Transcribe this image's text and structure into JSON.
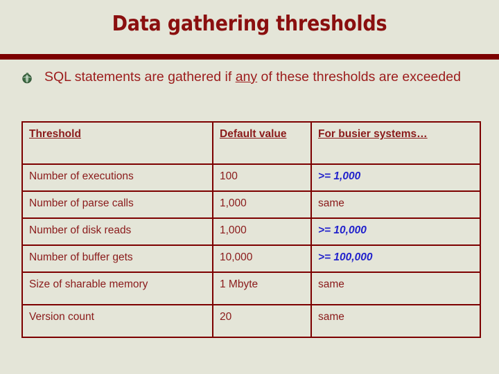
{
  "slide": {
    "title": "Data gathering thresholds",
    "title_color": "#8a0f0f",
    "background_color": "#e4e5d8",
    "divider_color": "#7c0000",
    "accent_color": "#2222cc",
    "body_text_color": "#9c1c1c"
  },
  "bullet": {
    "icon": "globe-bullet-icon",
    "text_before": "SQL statements are gathered if ",
    "text_emphasis": "any",
    "text_after": " of these thresholds are exceeded"
  },
  "table": {
    "headers": [
      "Threshold",
      "Default value",
      "For busier systems…"
    ],
    "rows": [
      {
        "threshold": "Number of executions",
        "default_value": "100",
        "busier": ">= 1,000",
        "busier_accent": true
      },
      {
        "threshold": "Number of parse calls",
        "default_value": "1,000",
        "busier": "same",
        "busier_accent": false
      },
      {
        "threshold": "Number of disk reads",
        "default_value": "1,000",
        "busier": ">= 10,000",
        "busier_accent": true
      },
      {
        "threshold": "Number of buffer gets",
        "default_value": "10,000",
        "busier": ">= 100,000",
        "busier_accent": true
      },
      {
        "threshold": "Size of sharable memory",
        "default_value": "1 Mbyte",
        "busier": "same",
        "busier_accent": false
      },
      {
        "threshold": "Version count",
        "default_value": "20",
        "busier": "same",
        "busier_accent": false
      }
    ]
  }
}
